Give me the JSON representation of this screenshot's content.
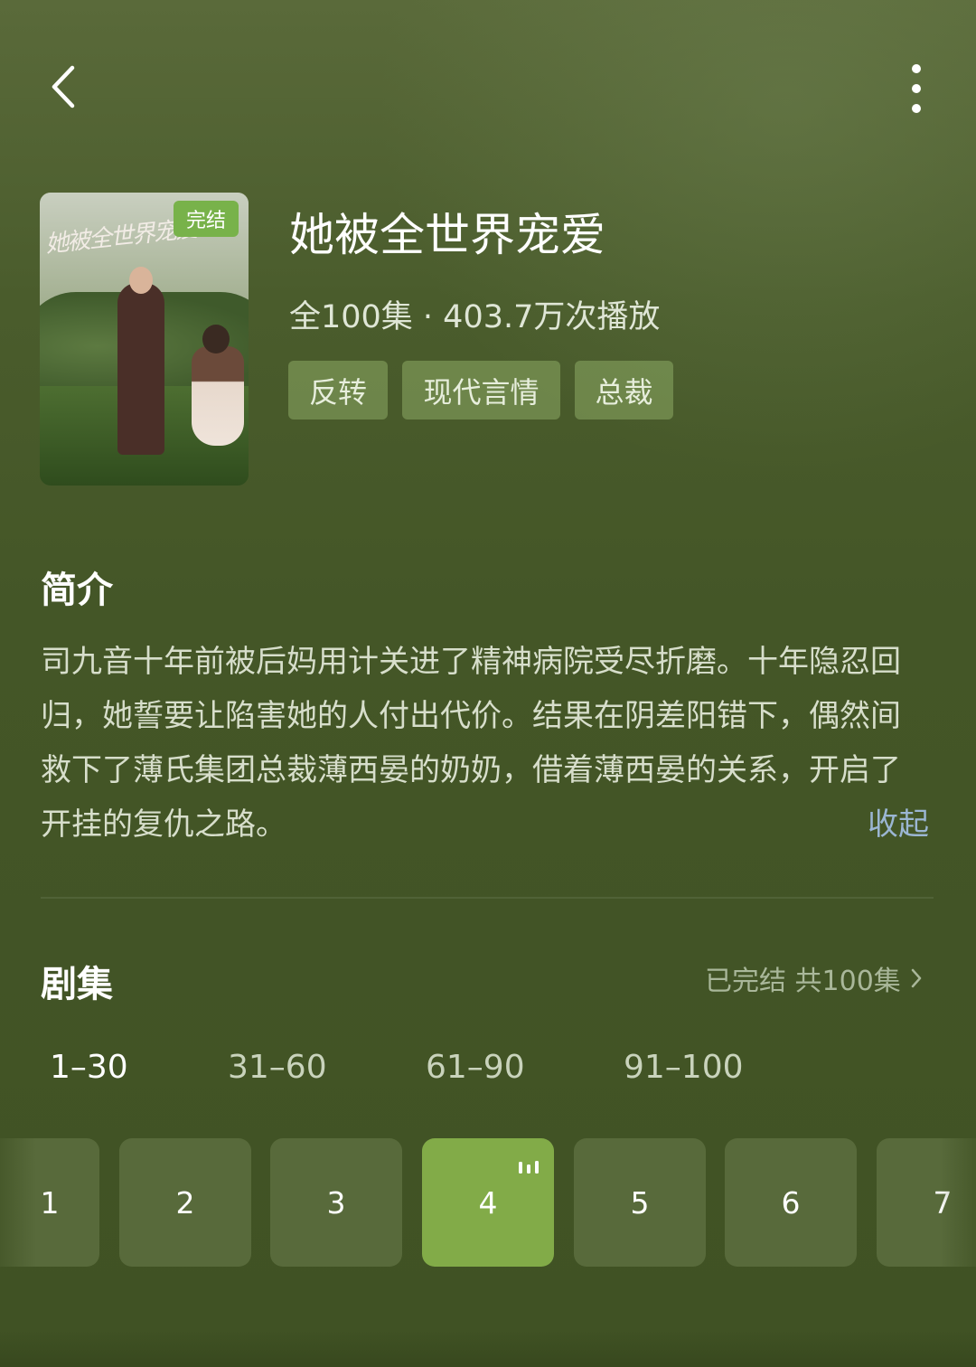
{
  "nav": {
    "back_icon": "chevron-left-icon",
    "more_icon": "more-vertical-icon"
  },
  "drama": {
    "title": "她被全世界宠爱",
    "meta": "全100集 · 403.7万次播放",
    "badge": "完结",
    "cover_script": "她被全世界宠爱",
    "tags": [
      "反转",
      "现代言情",
      "总裁"
    ]
  },
  "intro": {
    "heading": "简介",
    "text": "司九音十年前被后妈用计关进了精神病院受尽折磨。十年隐忍回归，她誓要让陷害她的人付出代价。结果在阴差阳错下，偶然间救下了薄氏集团总裁薄西晏的奶奶，借着薄西晏的关系，开启了开挂的复仇之路。",
    "collapse": "收起"
  },
  "episodes": {
    "heading": "剧集",
    "status": "已完结 共100集",
    "ranges": [
      "1–30",
      "31–60",
      "61–90",
      "91–100"
    ],
    "active_range": 0,
    "items": [
      "1",
      "2",
      "3",
      "4",
      "5",
      "6",
      "7"
    ],
    "current": "4"
  },
  "colors": {
    "accent": "#82ab48",
    "badge": "#78b24a",
    "link": "#9bb6d3"
  }
}
